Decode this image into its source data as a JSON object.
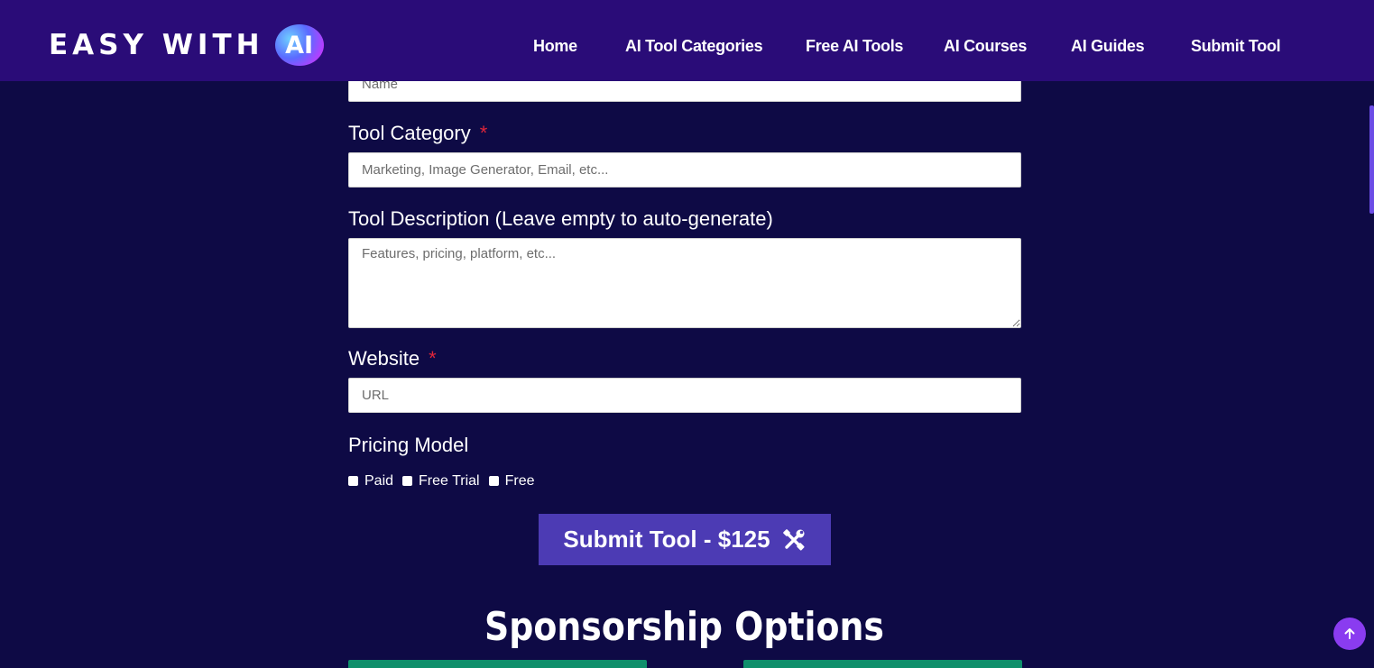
{
  "header": {
    "logo_text": "EASY WITH",
    "logo_badge": "AI",
    "nav": [
      {
        "label": "Home"
      },
      {
        "label": "AI Tool Categories"
      },
      {
        "label": "Free AI Tools"
      },
      {
        "label": "AI Courses"
      },
      {
        "label": "AI Guides"
      },
      {
        "label": "Submit Tool"
      }
    ]
  },
  "form": {
    "name_placeholder": "Name",
    "category": {
      "label": "Tool Category",
      "required_mark": "*",
      "placeholder": "Marketing, Image Generator, Email, etc..."
    },
    "description": {
      "label": "Tool Description (Leave empty to auto-generate)",
      "placeholder": "Features, pricing, platform, etc..."
    },
    "website": {
      "label": "Website",
      "required_mark": "*",
      "placeholder": "URL"
    },
    "pricing": {
      "label": "Pricing Model",
      "options": [
        {
          "label": "Paid",
          "checked": false
        },
        {
          "label": "Free Trial",
          "checked": false
        },
        {
          "label": "Free",
          "checked": false
        }
      ]
    },
    "submit_label": "Submit Tool - $125",
    "submit_icon": "tools-icon"
  },
  "sponsorship": {
    "title": "Sponsorship Options"
  },
  "colors": {
    "header_bg": "#2a0c78",
    "page_bg": "#0e0a45",
    "button_bg": "#4c3bb4",
    "required": "#e0263a",
    "card_green": "#0f8f6b",
    "scroll_top_bg": "#8a3cf0"
  }
}
